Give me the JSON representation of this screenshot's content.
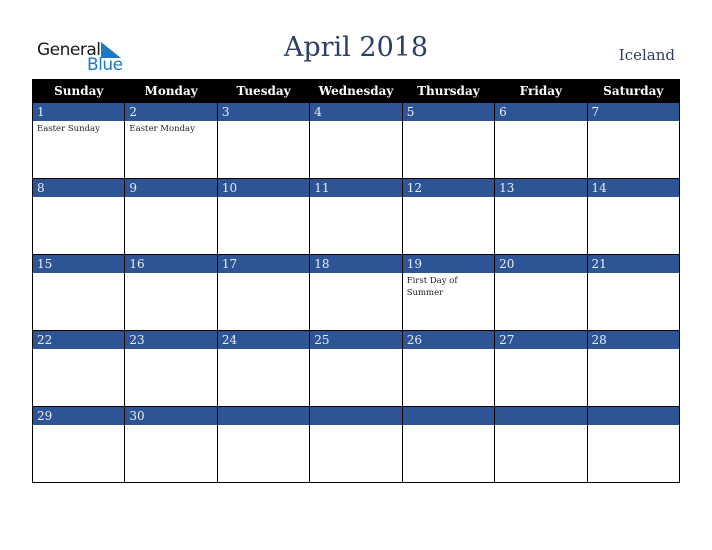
{
  "brand": {
    "line1": "General",
    "line2": "Blue",
    "icon": "triangle-logo-icon",
    "color": "#1f78c1"
  },
  "header": {
    "title": "April 2018",
    "country": "Iceland"
  },
  "colors": {
    "header_bg": "#000000",
    "daybar_bg": "#2d5494",
    "title": "#2b3f66"
  },
  "weekdays": [
    "Sunday",
    "Monday",
    "Tuesday",
    "Wednesday",
    "Thursday",
    "Friday",
    "Saturday"
  ],
  "weeks": [
    [
      {
        "day": "1",
        "event": "Easter Sunday"
      },
      {
        "day": "2",
        "event": "Easter Monday"
      },
      {
        "day": "3",
        "event": ""
      },
      {
        "day": "4",
        "event": ""
      },
      {
        "day": "5",
        "event": ""
      },
      {
        "day": "6",
        "event": ""
      },
      {
        "day": "7",
        "event": ""
      }
    ],
    [
      {
        "day": "8",
        "event": ""
      },
      {
        "day": "9",
        "event": ""
      },
      {
        "day": "10",
        "event": ""
      },
      {
        "day": "11",
        "event": ""
      },
      {
        "day": "12",
        "event": ""
      },
      {
        "day": "13",
        "event": ""
      },
      {
        "day": "14",
        "event": ""
      }
    ],
    [
      {
        "day": "15",
        "event": ""
      },
      {
        "day": "16",
        "event": ""
      },
      {
        "day": "17",
        "event": ""
      },
      {
        "day": "18",
        "event": ""
      },
      {
        "day": "19",
        "event": "First Day of Summer"
      },
      {
        "day": "20",
        "event": ""
      },
      {
        "day": "21",
        "event": ""
      }
    ],
    [
      {
        "day": "22",
        "event": ""
      },
      {
        "day": "23",
        "event": ""
      },
      {
        "day": "24",
        "event": ""
      },
      {
        "day": "25",
        "event": ""
      },
      {
        "day": "26",
        "event": ""
      },
      {
        "day": "27",
        "event": ""
      },
      {
        "day": "28",
        "event": ""
      }
    ],
    [
      {
        "day": "29",
        "event": ""
      },
      {
        "day": "30",
        "event": ""
      },
      {
        "day": "",
        "event": ""
      },
      {
        "day": "",
        "event": ""
      },
      {
        "day": "",
        "event": ""
      },
      {
        "day": "",
        "event": ""
      },
      {
        "day": "",
        "event": ""
      }
    ]
  ]
}
